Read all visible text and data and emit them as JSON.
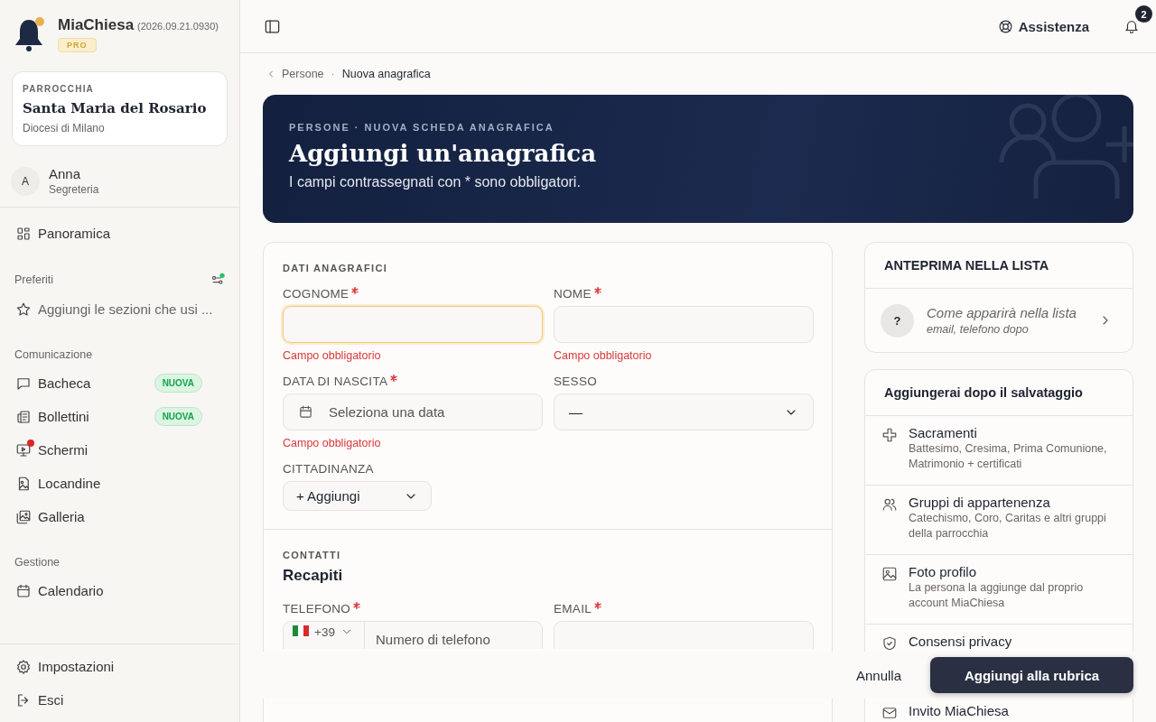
{
  "app": {
    "name": "MiaChiesa",
    "version": "(2026.09.21.0930)",
    "plan": "PRO"
  },
  "parish": {
    "label": "PARROCCHIA",
    "name": "Santa Maria del Rosario",
    "diocese": "Diocesi di Milano"
  },
  "user": {
    "initial": "A",
    "name": "Anna",
    "role": "Segreteria"
  },
  "sidebar": {
    "sections": [
      {
        "settings": false,
        "items": [
          {
            "label": "Panoramica",
            "kind": "link",
            "alert": false
          }
        ]
      },
      {
        "title": "Preferiti",
        "settings": true,
        "items": [
          {
            "label": "Aggiungi le sezioni che usi ...",
            "kind": "hint",
            "alert": false
          }
        ]
      },
      {
        "title": "Comunicazione",
        "settings": false,
        "items": [
          {
            "label": "Bacheca",
            "kind": "link",
            "badge": "NUOVA",
            "alert": false
          },
          {
            "label": "Bollettini",
            "kind": "link",
            "badge": "NUOVA",
            "alert": false
          },
          {
            "label": "Schermi",
            "kind": "link",
            "alert": true
          },
          {
            "label": "Locandine",
            "kind": "link",
            "alert": false
          },
          {
            "label": "Galleria",
            "kind": "link",
            "alert": false
          }
        ]
      },
      {
        "title": "Gestione",
        "settings": false,
        "items": [
          {
            "label": "Calendario",
            "kind": "link",
            "alert": false
          }
        ]
      }
    ],
    "footer_items": [
      {
        "label": "Impostazioni",
        "kind": "link",
        "alert": false
      },
      {
        "label": "Esci",
        "kind": "link",
        "alert": false
      }
    ]
  },
  "topbar": {
    "help": "Assistenza",
    "notifications": "2"
  },
  "breadcrumb": {
    "parent": "Persone",
    "separator": "·",
    "current": "Nuova anagrafica"
  },
  "hero": {
    "eyebrow": "PERSONE · NUOVA SCHEDA ANAGRAFICA",
    "title": "Aggiungi un'anagrafica",
    "subtitle": "I campi contrassegnati con * sono obbligatori."
  },
  "form": {
    "sections": [
      {
        "eyebrow": "DATI ANAGRAFICI",
        "fields": [
          {
            "label": "COGNOME",
            "kind": "text",
            "required": true,
            "focused": true,
            "error": "Campo obbligatorio"
          },
          {
            "label": "NOME",
            "kind": "text",
            "required": true,
            "focused": false,
            "error": "Campo obbligatorio"
          },
          {
            "label": "DATA DI NASCITA",
            "kind": "date",
            "required": true,
            "placeholder": "Seleziona una data",
            "error": "Campo obbligatorio"
          },
          {
            "label": "SESSO",
            "kind": "select",
            "required": false,
            "value": "—"
          },
          {
            "label": "CITTADINANZA",
            "kind": "add",
            "required": false,
            "value": "+ Aggiungi"
          }
        ]
      },
      {
        "eyebrow": "CONTATTI",
        "title": "Recapiti",
        "fields": [
          {
            "label": "TELEFONO",
            "kind": "phone",
            "required": true,
            "prefix": "+39",
            "placeholder": "Numero di telefono"
          },
          {
            "label": "EMAIL",
            "kind": "text",
            "required": true,
            "focused": false
          }
        ]
      }
    ]
  },
  "preview": {
    "title": "ANTEPRIMA NELLA LISTA",
    "avatar": "?",
    "name": "Come apparirà nella lista",
    "detail": "email, telefono dopo"
  },
  "after_save": {
    "title": "Aggiungerai dopo il salvataggio",
    "items": [
      {
        "title": "Sacramenti",
        "description": "Battesimo, Cresima, Prima Comunione, Matrimonio + certificati"
      },
      {
        "title": "Gruppi di appartenenza",
        "description": "Catechismo, Coro, Caritas e altri gruppi della parrocchia"
      },
      {
        "title": "Foto profilo",
        "description": "La persona la aggiunge dal proprio account MiaChiesa"
      },
      {
        "title": "Consensi privacy"
      },
      {
        "title": "Invito MiaChiesa"
      }
    ]
  },
  "actions": {
    "cancel": "Annulla",
    "submit": "Aggiungi alla rubrica"
  }
}
